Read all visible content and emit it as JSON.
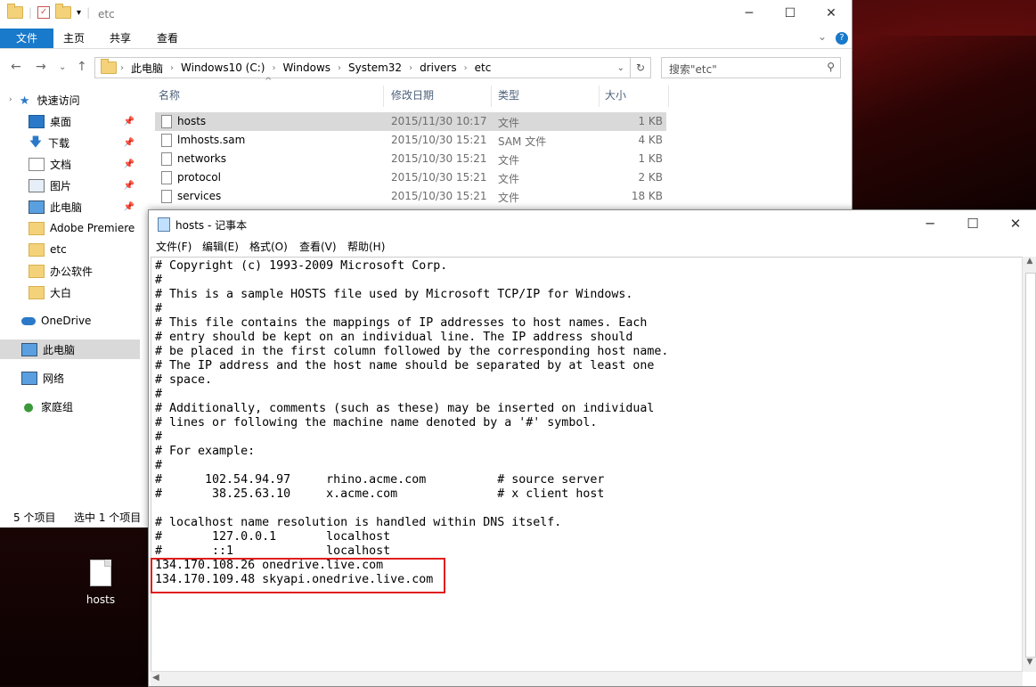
{
  "explorer": {
    "title": "etc",
    "ribbon": {
      "file": "文件",
      "home": "主页",
      "share": "共享",
      "view": "查看"
    },
    "breadcrumbs": [
      "此电脑",
      "Windows10 (C:)",
      "Windows",
      "System32",
      "drivers",
      "etc"
    ],
    "search_placeholder": "搜索\"etc\"",
    "nav": {
      "quick_access": "快速访问",
      "desktop": "桌面",
      "downloads": "下载",
      "documents": "文档",
      "pictures": "图片",
      "this_pc_pinned": "此电脑",
      "adobe": "Adobe Premiere",
      "etc": "etc",
      "office": "办公软件",
      "dabai": "大白",
      "onedrive": "OneDrive",
      "this_pc": "此电脑",
      "network": "网络",
      "homegroup": "家庭组"
    },
    "columns": {
      "name": "名称",
      "date": "修改日期",
      "type": "类型",
      "size": "大小"
    },
    "files": [
      {
        "name": "hosts",
        "date": "2015/11/30 10:17",
        "type": "文件",
        "size": "1 KB"
      },
      {
        "name": "lmhosts.sam",
        "date": "2015/10/30 15:21",
        "type": "SAM 文件",
        "size": "4 KB"
      },
      {
        "name": "networks",
        "date": "2015/10/30 15:21",
        "type": "文件",
        "size": "1 KB"
      },
      {
        "name": "protocol",
        "date": "2015/10/30 15:21",
        "type": "文件",
        "size": "2 KB"
      },
      {
        "name": "services",
        "date": "2015/10/30 15:21",
        "type": "文件",
        "size": "18 KB"
      }
    ],
    "status": {
      "count": "5 个项目",
      "selected": "选中 1 个项目"
    }
  },
  "desktop": {
    "icon_label": "hosts"
  },
  "notepad": {
    "title": "hosts - 记事本",
    "menu": {
      "file": "文件(F)",
      "edit": "编辑(E)",
      "format": "格式(O)",
      "view": "查看(V)",
      "help": "帮助(H)"
    },
    "content": "# Copyright (c) 1993-2009 Microsoft Corp.\n#\n# This is a sample HOSTS file used by Microsoft TCP/IP for Windows.\n#\n# This file contains the mappings of IP addresses to host names. Each\n# entry should be kept on an individual line. The IP address should\n# be placed in the first column followed by the corresponding host name.\n# The IP address and the host name should be separated by at least one\n# space.\n#\n# Additionally, comments (such as these) may be inserted on individual\n# lines or following the machine name denoted by a '#' symbol.\n#\n# For example:\n#\n#      102.54.94.97     rhino.acme.com          # source server\n#       38.25.63.10     x.acme.com              # x client host\n\n# localhost name resolution is handled within DNS itself.\n#\t127.0.0.1       localhost\n#\t::1             localhost\n134.170.108.26 onedrive.live.com\n134.170.109.48 skyapi.onedrive.live.com"
  }
}
